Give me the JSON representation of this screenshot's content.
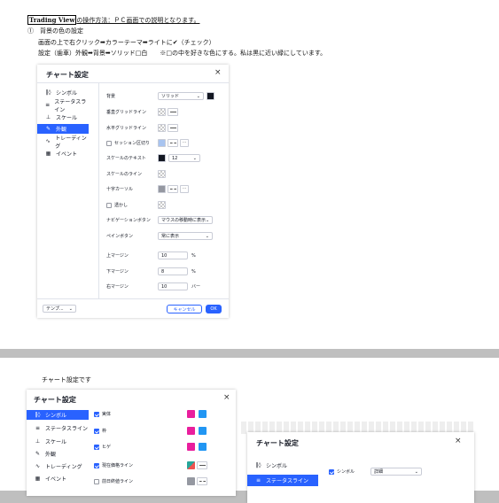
{
  "doc": {
    "title_prefix": "Trading View",
    "title_suffix": "の操作方法：ＰＣ画面での説明となります。",
    "item1": "①　背景の色の設定",
    "item1_line1": "画面の上で右クリック➡カラーテーマ➡ライトに✔（チェック）",
    "item1_line2": "設定（歯車）外観➡背景➡ソリッド□白　　※□の中を好きな色にする。私は黒に近い緑にしています。",
    "page2_text": "チャート設定です"
  },
  "dialog1": {
    "title": "チャート設定",
    "close": "×",
    "nav": [
      {
        "icon": "‖◊",
        "label": "シンボル"
      },
      {
        "icon": "≡",
        "label": "ステータスライン"
      },
      {
        "icon": "⊥",
        "label": "スケール"
      },
      {
        "icon": "✎",
        "label": "外観"
      },
      {
        "icon": "∿",
        "label": "トレーディング"
      },
      {
        "icon": "▦",
        "label": "イベント"
      }
    ],
    "rows": {
      "background": {
        "label": "背景",
        "value": "ソリッド"
      },
      "vgrid": {
        "label": "垂直グリッドライン"
      },
      "hgrid": {
        "label": "水平グリッドライン"
      },
      "session": {
        "label": "セッション区切り"
      },
      "scale_text": {
        "label": "スケールのテキスト",
        "value": "12"
      },
      "scale_line": {
        "label": "スケールのライン"
      },
      "crosshair": {
        "label": "十字カーソル"
      },
      "watermark": {
        "label": "透かし"
      },
      "navbtn": {
        "label": "ナビゲーションボタン",
        "value": "マウスの移動時に表示"
      },
      "panebtn": {
        "label": "ペインボタン",
        "value": "常に表示"
      },
      "top_margin": {
        "label": "上マージン",
        "value": "10",
        "unit": "%"
      },
      "bottom_margin": {
        "label": "下マージン",
        "value": "8",
        "unit": "%"
      },
      "right_margin": {
        "label": "右マージン",
        "value": "10",
        "unit": "バー"
      }
    },
    "template": "テンプ...",
    "cancel": "キャンセル",
    "ok": "OK"
  },
  "dialog2": {
    "title": "チャート設定",
    "close": "×",
    "nav": [
      {
        "icon": "‖◊",
        "label": "シンボル"
      },
      {
        "icon": "≡",
        "label": "ステータスライン"
      },
      {
        "icon": "⊥",
        "label": "スケール"
      },
      {
        "icon": "✎",
        "label": "外観"
      },
      {
        "icon": "∿",
        "label": "トレーディング"
      },
      {
        "icon": "▦",
        "label": "イベント"
      }
    ],
    "rows": [
      {
        "label": "実体",
        "checked": true
      },
      {
        "label": "枠",
        "checked": true
      },
      {
        "label": "ヒゲ",
        "checked": true
      },
      {
        "label": "現在価格ライン",
        "checked": true
      },
      {
        "label": "前日終値ライン",
        "checked": false
      }
    ]
  },
  "dialog3": {
    "title": "チャート設定",
    "close": "×",
    "nav": [
      {
        "icon": "‖◊",
        "label": "シンボル"
      },
      {
        "icon": "≡",
        "label": "ステータスライン"
      }
    ],
    "symbol_label": "シンボル",
    "symbol_value": "詳細"
  },
  "colors": {
    "accent": "#2962ff",
    "up": "#e91e9d",
    "down": "#2196f3",
    "bg_swatch": "#131722"
  }
}
